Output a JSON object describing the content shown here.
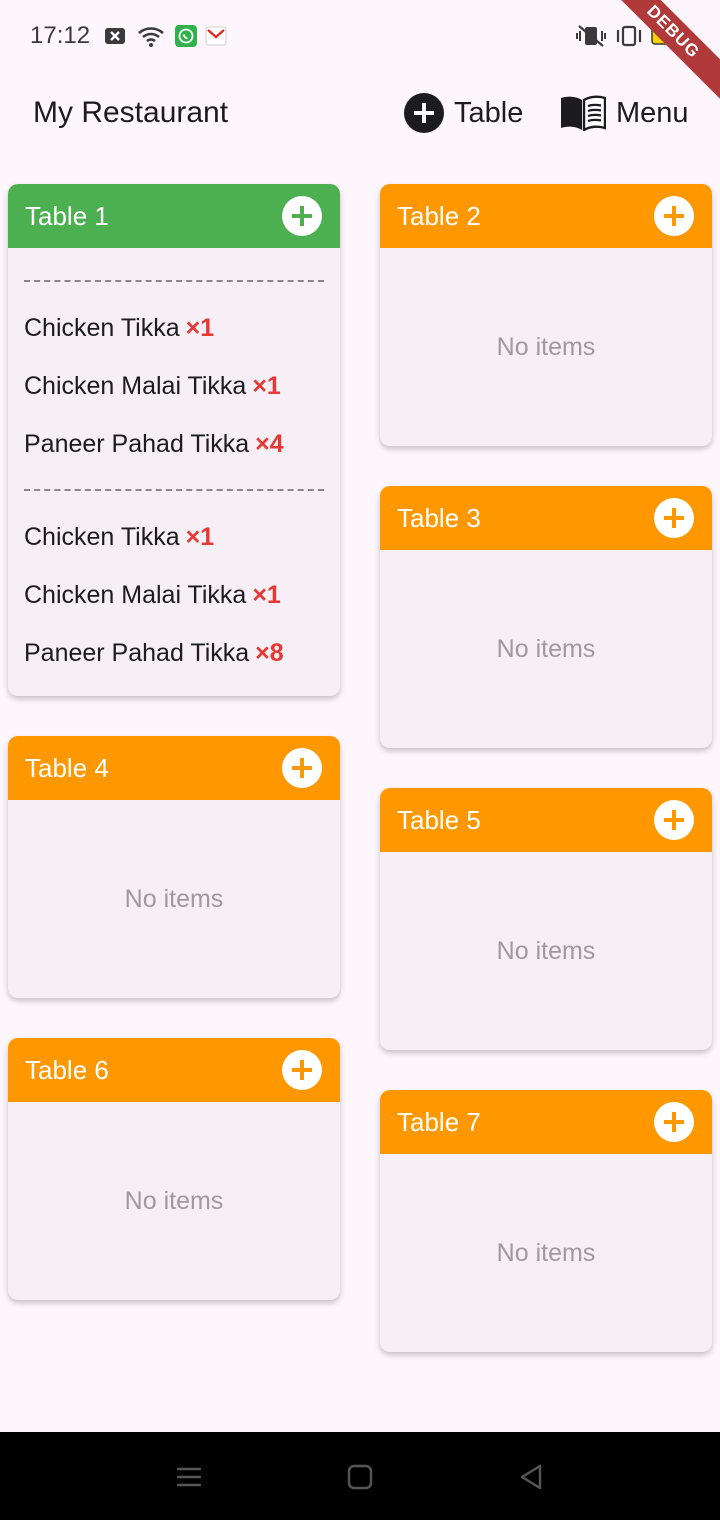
{
  "status_bar": {
    "time": "17:12",
    "debug_label": "DEBUG",
    "icons": [
      "x-notification-icon",
      "wifi-icon",
      "whatsapp-icon",
      "gmail-icon",
      "vibrate-icon",
      "rotate-icon",
      "battery-icon"
    ]
  },
  "app_bar": {
    "title": "My Restaurant",
    "add_table_label": "Table",
    "menu_label": "Menu"
  },
  "colors": {
    "occupied": "#4caf50",
    "free": "#ff9800",
    "quantity": "#e53935"
  },
  "tables": [
    {
      "name": "Table 1",
      "status": "occupied",
      "orders": [
        [
          {
            "item": "Chicken Tikka",
            "qty": "×1"
          },
          {
            "item": "Chicken Malai Tikka",
            "qty": "×1"
          },
          {
            "item": "Paneer Pahad Tikka",
            "qty": "×4"
          }
        ],
        [
          {
            "item": "Chicken Tikka",
            "qty": "×1"
          },
          {
            "item": "Chicken Malai Tikka",
            "qty": "×1"
          },
          {
            "item": "Paneer Pahad Tikka",
            "qty": "×8"
          }
        ]
      ]
    },
    {
      "name": "Table 2",
      "status": "free",
      "empty_text": "No items"
    },
    {
      "name": "Table 3",
      "status": "free",
      "empty_text": "No items"
    },
    {
      "name": "Table 4",
      "status": "free",
      "empty_text": "No items"
    },
    {
      "name": "Table 5",
      "status": "free",
      "empty_text": "No items"
    },
    {
      "name": "Table 6",
      "status": "free",
      "empty_text": "No items"
    },
    {
      "name": "Table 7",
      "status": "free",
      "empty_text": "No items"
    }
  ]
}
